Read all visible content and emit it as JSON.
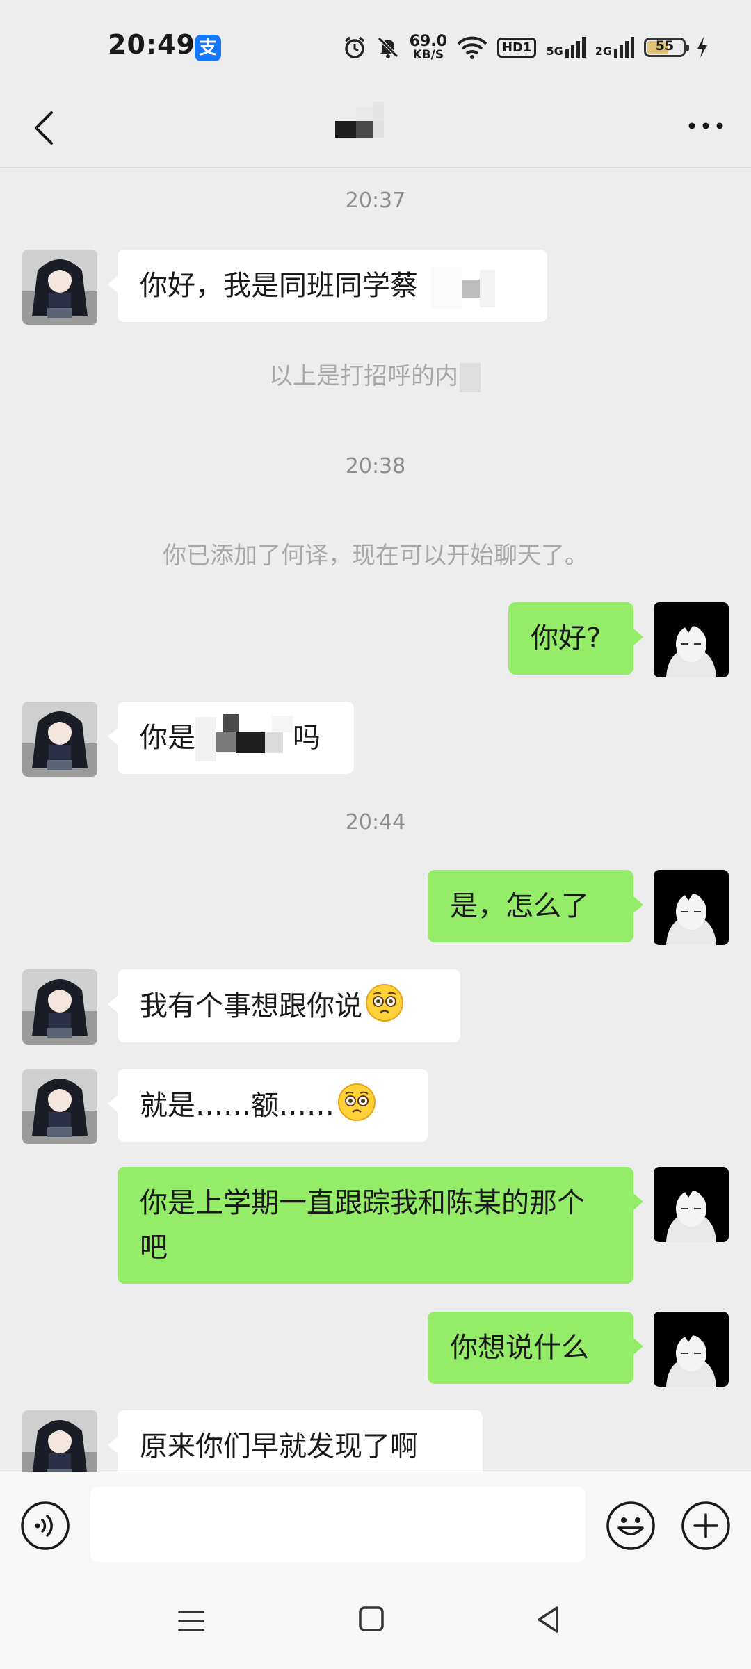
{
  "status_bar": {
    "time": "20:49",
    "alipay_label": "支",
    "net_speed_value": "69.0",
    "net_speed_unit": "KB/S",
    "hd_label": "HD1",
    "sim1_label": "5G",
    "sim2_label": "2G",
    "battery_level": "55",
    "icons": [
      "alarm-icon",
      "mute-icon",
      "wifi-icon",
      "charging-icon"
    ]
  },
  "header": {
    "back_icon": "back-chevron-icon",
    "more_icon": "more-dots-icon"
  },
  "chat": {
    "timestamps": [
      "20:37",
      "20:38",
      "20:44"
    ],
    "system_messages": [
      "以上是打招呼的内",
      "你已添加了何译，现在可以开始聊天了。"
    ],
    "messages": [
      {
        "side": "in",
        "text": "你好，我是同班同学蔡"
      },
      {
        "side": "out",
        "text": "你好?"
      },
      {
        "side": "in",
        "text_before": "你是",
        "text_after": "吗"
      },
      {
        "side": "out",
        "text": "是，怎么了"
      },
      {
        "side": "in",
        "text": "我有个事想跟你说",
        "emoji": "pleading-face"
      },
      {
        "side": "in",
        "text": "就是……额……",
        "emoji": "pleading-face"
      },
      {
        "side": "out",
        "text": "你是上学期一直跟踪我和陈某的那个吧"
      },
      {
        "side": "out",
        "text": "你想说什么"
      },
      {
        "side": "in",
        "text": "原来你们早就发现了啊"
      }
    ]
  },
  "input_bar": {
    "value": "",
    "placeholder": "",
    "voice_icon": "voice-icon",
    "emoji_icon": "emoji-icon",
    "plus_icon": "plus-icon"
  },
  "colors": {
    "background": "#ededed",
    "outgoing_bubble": "#95ec69",
    "incoming_bubble": "#ffffff",
    "timestamp_text": "#8d8d8d",
    "system_text": "#a8a8a8"
  }
}
